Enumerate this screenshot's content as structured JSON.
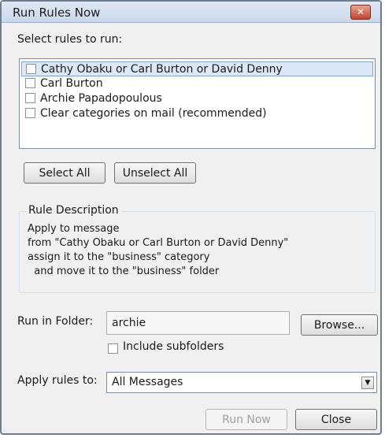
{
  "window": {
    "title": "Run Rules Now",
    "close_glyph": "✕"
  },
  "rules_section": {
    "label": "Select rules to run:",
    "items": [
      {
        "label": "Cathy Obaku or Carl Burton or David Denny",
        "checked": false,
        "selected": true
      },
      {
        "label": "Carl Burton",
        "checked": false,
        "selected": false
      },
      {
        "label": "Archie Papadopoulous",
        "checked": false,
        "selected": false
      },
      {
        "label": "Clear categories on mail (recommended)",
        "checked": false,
        "selected": false
      }
    ]
  },
  "buttons": {
    "select_all": "Select All",
    "unselect_all": "Unselect All",
    "browse": "Browse...",
    "run_now": "Run Now",
    "close": "Close"
  },
  "rule_description": {
    "title": "Rule Description",
    "lines": [
      "Apply to message",
      "from \"Cathy Obaku or Carl Burton or David Denny\"",
      "assign it to the \"business\" category",
      "  and move it to the \"business\" folder"
    ]
  },
  "run_in_folder": {
    "label": "Run in Folder:",
    "value": "archie"
  },
  "include_subfolders": {
    "label": "Include subfolders",
    "checked": false
  },
  "apply_rules_to": {
    "label": "Apply rules to:",
    "value": "All Messages"
  },
  "colors": {
    "selection": "#dbe8f7",
    "dialog_bg": "#f0f0f0",
    "close_button": "#c0452e"
  }
}
